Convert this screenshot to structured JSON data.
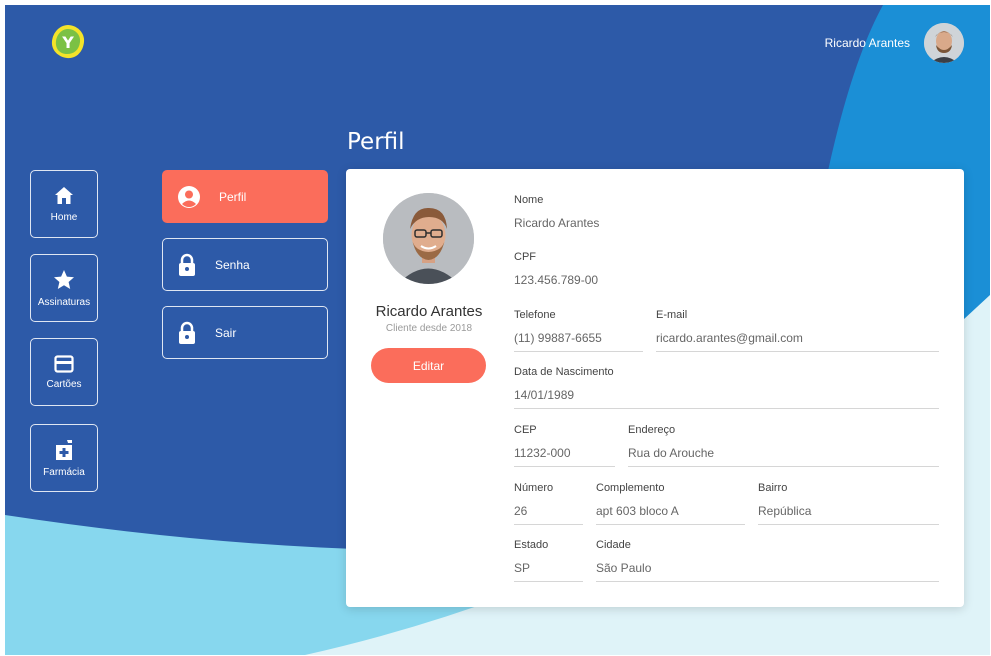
{
  "header": {
    "user_name": "Ricardo Arantes",
    "logo_letter": "Y"
  },
  "page_title": "Perfil",
  "sidebar": {
    "items": [
      {
        "label": "Home",
        "icon": "home-icon"
      },
      {
        "label": "Assinaturas",
        "icon": "star-icon"
      },
      {
        "label": "Cartões",
        "icon": "card-icon"
      },
      {
        "label": "Farmácia",
        "icon": "pharmacy-icon"
      }
    ]
  },
  "menu": {
    "items": [
      {
        "label": "Perfil",
        "icon": "user-icon",
        "active": true
      },
      {
        "label": "Senha",
        "icon": "lock-icon",
        "active": false
      },
      {
        "label": "Sair",
        "icon": "lock-icon",
        "active": false
      }
    ]
  },
  "profile": {
    "name": "Ricardo Arantes",
    "since": "Cliente desde 2018",
    "edit_label": "Editar"
  },
  "form": {
    "nome": {
      "label": "Nome",
      "value": "Ricardo Arantes"
    },
    "cpf": {
      "label": "CPF",
      "value": "123.456.789-00"
    },
    "telefone": {
      "label": "Telefone",
      "value": "(11) 99887-6655"
    },
    "email": {
      "label": "E-mail",
      "value": "ricardo.arantes@gmail.com"
    },
    "nascimento": {
      "label": "Data de Nascimento",
      "value": "14/01/1989"
    },
    "cep": {
      "label": "CEP",
      "value": "11232-000"
    },
    "endereco": {
      "label": "Endereço",
      "value": "Rua do Arouche"
    },
    "numero": {
      "label": "Número",
      "value": "26"
    },
    "complemento": {
      "label": "Complemento",
      "value": "apt 603 bloco A"
    },
    "bairro": {
      "label": "Bairro",
      "value": "República"
    },
    "estado": {
      "label": "Estado",
      "value": "SP"
    },
    "cidade": {
      "label": "Cidade",
      "value": "São Paulo"
    }
  },
  "colors": {
    "background_blue": "#2d5aa8",
    "accent_blue": "#1b8fd6",
    "light_blue": "#87d7ee",
    "coral": "#fb6d5b",
    "logo_yellow": "#f3e32a"
  }
}
